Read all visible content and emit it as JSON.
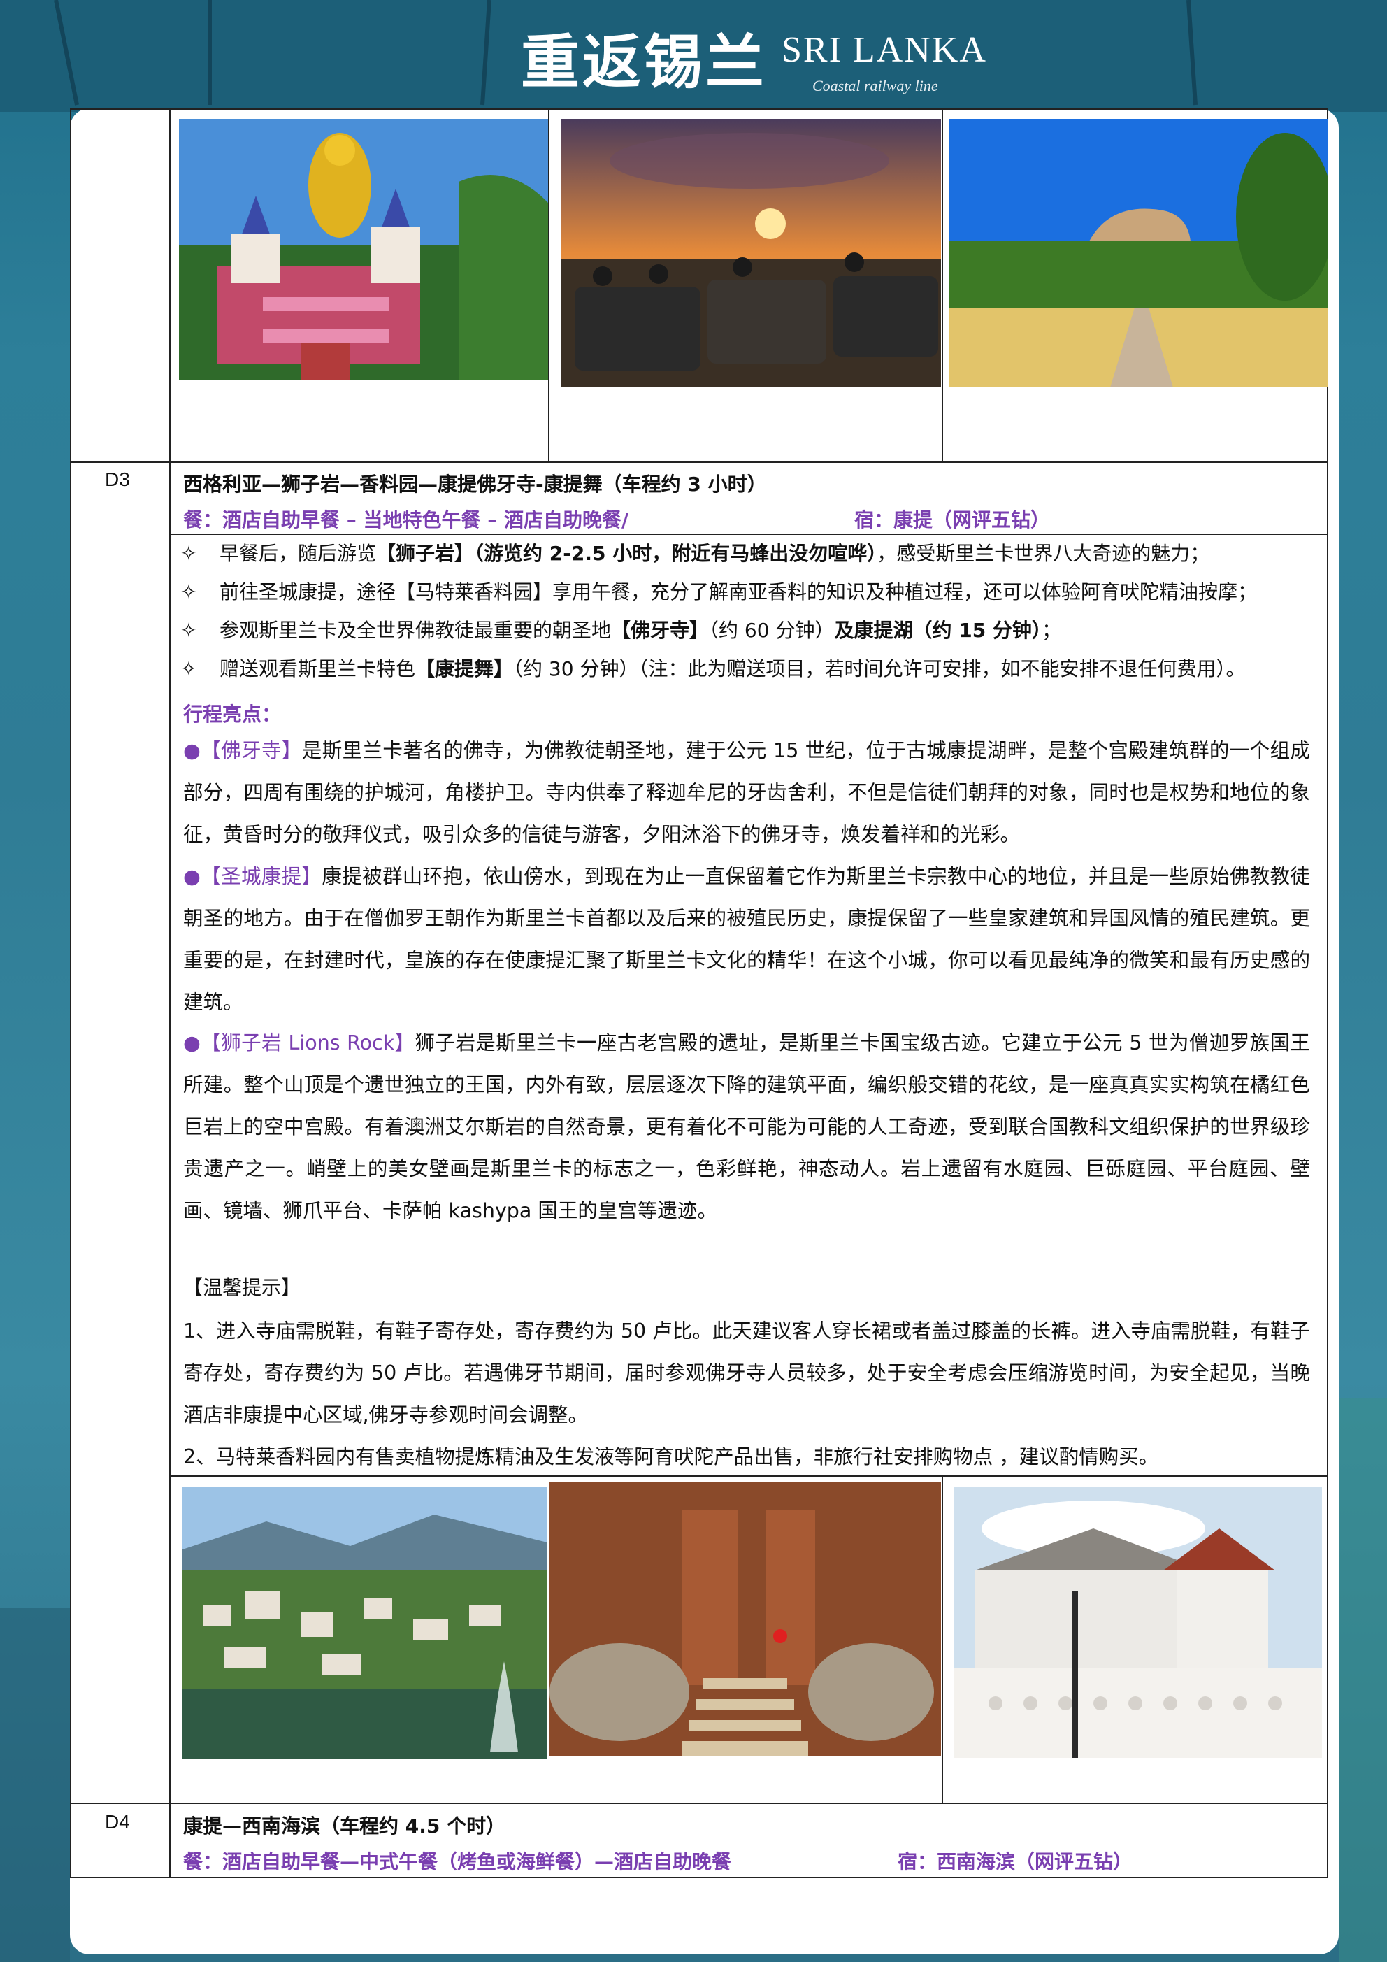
{
  "header": {
    "title_cn": "重返锡兰",
    "title_en": "SRI LANKA",
    "subtitle": "Coastal railway line"
  },
  "top_photos": [
    {
      "name": "golden-buddha-temple-photo"
    },
    {
      "name": "safari-jeeps-sunset-photo"
    },
    {
      "name": "lions-rock-garden-photo"
    }
  ],
  "d3": {
    "day": "D3",
    "title": "西格利亚—狮子岩—香料园—康提佛牙寺-康提舞（车程约 3 小时）",
    "meals": "餐：酒店自助早餐 – 当地特色午餐 – 酒店自助晚餐/",
    "stay": "宿：康提（网评五钻）",
    "bullets": [
      {
        "marker": "✧",
        "a": "早餐后，随后游览",
        "b": "【狮子岩】（游览约 2-2.5 小时，附近有马蜂出没勿喧哗）",
        "c": "，感受斯里兰卡世界八大奇迹的魅力；",
        "d": "",
        "e": ""
      },
      {
        "marker": "✧",
        "a": "前往圣城康提，途径【马特莱香料园】享用午餐，充分了解南亚香料的知识及种植过程，还可以体验阿育吠陀精油按摩；",
        "b": "",
        "c": "",
        "d": "",
        "e": ""
      },
      {
        "marker": "✧",
        "a": "参观斯里兰卡及全世界佛教徒最重要的朝圣地",
        "b": "【佛牙寺】",
        "c": "（约 60 分钟）",
        "d": "及康提湖（约 15 分钟）",
        "e": "；"
      },
      {
        "marker": "✧",
        "a": "赠送观看斯里兰卡特色",
        "b": "【康提舞】",
        "c": "（约 30 分钟）（注：此为赠送项目，若时间允许可安排，如不能安排不退任何费用）。",
        "d": "",
        "e": ""
      }
    ],
    "highlights_title": "行程亮点：",
    "highlights": [
      {
        "tag": "●【佛牙寺】",
        "text": "是斯里兰卡著名的佛寺，为佛教徒朝圣地，建于公元 15 世纪，位于古城康提湖畔，是整个宫殿建筑群的一个组成部分，四周有围绕的护城河，角楼护卫。寺内供奉了释迦牟尼的牙齿舍利，不但是信徒们朝拜的对象，同时也是权势和地位的象征，黄昏时分的敬拜仪式，吸引众多的信徒与游客，夕阳沐浴下的佛牙寺，焕发着祥和的光彩。"
      },
      {
        "tag": "●【圣城康提】",
        "text": "康提被群山环抱，依山傍水，到现在为止一直保留着它作为斯里兰卡宗教中心的地位，并且是一些原始佛教教徒朝圣的地方。由于在僧伽罗王朝作为斯里兰卡首都以及后来的被殖民历史，康提保留了一些皇家建筑和异国风情的殖民建筑。更重要的是，在封建时代，皇族的存在使康提汇聚了斯里兰卡文化的精华！在这个小城，你可以看见最纯净的微笑和最有历史感的建筑。"
      },
      {
        "tag": "●【狮子岩 Lions Rock】",
        "text": "狮子岩是斯里兰卡一座古老宫殿的遗址，是斯里兰卡国宝级古迹。它建立于公元 5 世为僧迦罗族国王所建。整个山顶是个遗世独立的王国，内外有致，层层逐次下降的建筑平面，编织般交错的花纹，是一座真真实实构筑在橘红色巨岩上的空中宫殿。有着澳洲艾尔斯岩的自然奇景，更有着化不可能为可能的人工奇迹，受到联合国教科文组织保护的世界级珍贵遗产之一。峭壁上的美女壁画是斯里兰卡的标志之一，色彩鲜艳，神态动人。岩上遗留有水庭园、巨砾庭园、平台庭园、壁画、镜墙、狮爪平台、卡萨帕 kashypa 国王的皇宫等遗迹。"
      }
    ],
    "tips_title": "【温馨提示】",
    "tips": [
      "1、进入寺庙需脱鞋，有鞋子寄存处，寄存费约为 50 卢比。此天建议客人穿长裙或者盖过膝盖的长裤。进入寺庙需脱鞋，有鞋子寄存处，寄存费约为 50 卢比。若遇佛牙节期间，届时参观佛牙寺人员较多，处于安全考虑会压缩游览时间，为安全起见，当晚酒店非康提中心区域,佛牙寺参观时间会调整。",
      "2、马特莱香料园内有售卖植物提炼精油及生发液等阿育吠陀产品出售，非旅行社安排购物点 ，建议酌情购买。"
    ]
  },
  "d4": {
    "day": "D4",
    "title": "康提—西南海滨（车程约 4.5 个时）",
    "meals": "餐：酒店自助早餐—中式午餐（烤鱼或海鲜餐）—酒店自助晚餐",
    "stay": "宿：西南海滨（网评五钻）"
  },
  "colors": {
    "accent": "#7a3fb0",
    "ocean": "#2d7f99"
  }
}
